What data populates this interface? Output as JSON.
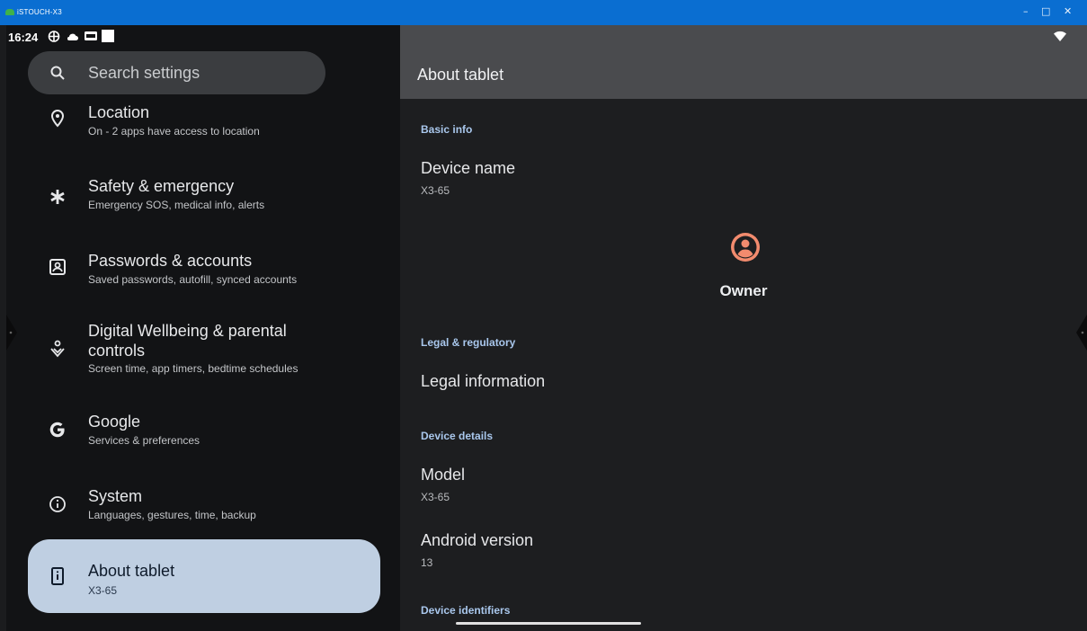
{
  "window": {
    "title": "iSTOUCH-X3",
    "controls": {
      "minimize": "–",
      "maximize": "□",
      "close": "✕"
    }
  },
  "statusbar": {
    "time": "16:24",
    "icons": [
      "gamepad-icon",
      "cloud-icon",
      "dvr-badge-icon",
      "blank-square-icon",
      "wifi-icon"
    ]
  },
  "search": {
    "placeholder": "Search settings",
    "icon": "search-icon"
  },
  "sidebar": {
    "items": [
      {
        "icon": "location-pin-icon",
        "title": "Location",
        "subtitle": "On - 2 apps have access to location"
      },
      {
        "icon": "asterisk-icon",
        "title": "Safety & emergency",
        "subtitle": "Emergency SOS, medical info, alerts"
      },
      {
        "icon": "account-box-icon",
        "title": "Passwords & accounts",
        "subtitle": "Saved passwords, autofill, synced accounts"
      },
      {
        "icon": "wellbeing-icon",
        "title_line1": "Digital Wellbeing & parental",
        "title_line2": "controls",
        "subtitle": "Screen time, app timers, bedtime schedules"
      },
      {
        "icon": "google-g-icon",
        "title": "Google",
        "subtitle": "Services & preferences"
      },
      {
        "icon": "info-icon",
        "title": "System",
        "subtitle": "Languages, gestures, time, backup"
      },
      {
        "icon": "tablet-info-icon",
        "title": "About tablet",
        "subtitle": "X3-65",
        "selected": true
      }
    ]
  },
  "detail": {
    "title": "About tablet",
    "basic_info_header": "Basic info",
    "device_name_label": "Device name",
    "device_name_value": "X3-65",
    "owner_label": "Owner",
    "legal_header": "Legal & regulatory",
    "legal_information": "Legal information",
    "device_details_header": "Device details",
    "model_label": "Model",
    "model_value": "X3-65",
    "android_version_label": "Android version",
    "android_version_value": "13",
    "device_identifiers_header": "Device identifiers"
  },
  "colors": {
    "titlebar": "#0a6ed1",
    "selected_item": "#bfcfe2",
    "category_header": "#a9c7ec",
    "owner_icon": "#f28b6e"
  }
}
